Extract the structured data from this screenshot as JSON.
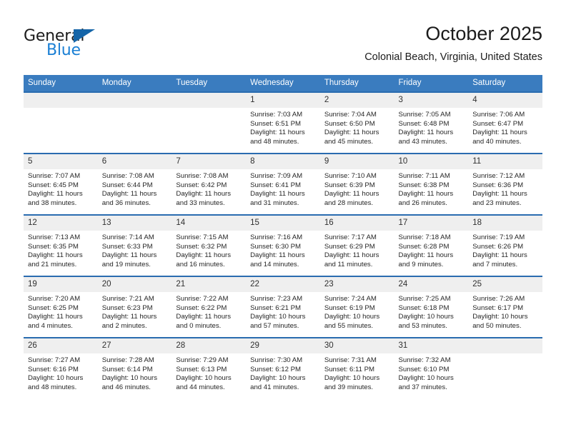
{
  "brand": {
    "name_top": "General",
    "name_bottom": "Blue",
    "triangle_color": "#1565a8",
    "blue_color": "#1a7fd4"
  },
  "header": {
    "title": "October 2025",
    "subtitle": "Colonial Beach, Virginia, United States"
  },
  "theme": {
    "header_blue": "#3a7cbf",
    "row_rule_blue": "#2a6cb0",
    "daynum_band": "#efefef"
  },
  "weekdays": [
    "Sunday",
    "Monday",
    "Tuesday",
    "Wednesday",
    "Thursday",
    "Friday",
    "Saturday"
  ],
  "weeks": [
    [
      {
        "day": "",
        "lines": []
      },
      {
        "day": "",
        "lines": []
      },
      {
        "day": "",
        "lines": []
      },
      {
        "day": "1",
        "lines": [
          "Sunrise: 7:03 AM",
          "Sunset: 6:51 PM",
          "Daylight: 11 hours",
          "and 48 minutes."
        ]
      },
      {
        "day": "2",
        "lines": [
          "Sunrise: 7:04 AM",
          "Sunset: 6:50 PM",
          "Daylight: 11 hours",
          "and 45 minutes."
        ]
      },
      {
        "day": "3",
        "lines": [
          "Sunrise: 7:05 AM",
          "Sunset: 6:48 PM",
          "Daylight: 11 hours",
          "and 43 minutes."
        ]
      },
      {
        "day": "4",
        "lines": [
          "Sunrise: 7:06 AM",
          "Sunset: 6:47 PM",
          "Daylight: 11 hours",
          "and 40 minutes."
        ]
      }
    ],
    [
      {
        "day": "5",
        "lines": [
          "Sunrise: 7:07 AM",
          "Sunset: 6:45 PM",
          "Daylight: 11 hours",
          "and 38 minutes."
        ]
      },
      {
        "day": "6",
        "lines": [
          "Sunrise: 7:08 AM",
          "Sunset: 6:44 PM",
          "Daylight: 11 hours",
          "and 36 minutes."
        ]
      },
      {
        "day": "7",
        "lines": [
          "Sunrise: 7:08 AM",
          "Sunset: 6:42 PM",
          "Daylight: 11 hours",
          "and 33 minutes."
        ]
      },
      {
        "day": "8",
        "lines": [
          "Sunrise: 7:09 AM",
          "Sunset: 6:41 PM",
          "Daylight: 11 hours",
          "and 31 minutes."
        ]
      },
      {
        "day": "9",
        "lines": [
          "Sunrise: 7:10 AM",
          "Sunset: 6:39 PM",
          "Daylight: 11 hours",
          "and 28 minutes."
        ]
      },
      {
        "day": "10",
        "lines": [
          "Sunrise: 7:11 AM",
          "Sunset: 6:38 PM",
          "Daylight: 11 hours",
          "and 26 minutes."
        ]
      },
      {
        "day": "11",
        "lines": [
          "Sunrise: 7:12 AM",
          "Sunset: 6:36 PM",
          "Daylight: 11 hours",
          "and 23 minutes."
        ]
      }
    ],
    [
      {
        "day": "12",
        "lines": [
          "Sunrise: 7:13 AM",
          "Sunset: 6:35 PM",
          "Daylight: 11 hours",
          "and 21 minutes."
        ]
      },
      {
        "day": "13",
        "lines": [
          "Sunrise: 7:14 AM",
          "Sunset: 6:33 PM",
          "Daylight: 11 hours",
          "and 19 minutes."
        ]
      },
      {
        "day": "14",
        "lines": [
          "Sunrise: 7:15 AM",
          "Sunset: 6:32 PM",
          "Daylight: 11 hours",
          "and 16 minutes."
        ]
      },
      {
        "day": "15",
        "lines": [
          "Sunrise: 7:16 AM",
          "Sunset: 6:30 PM",
          "Daylight: 11 hours",
          "and 14 minutes."
        ]
      },
      {
        "day": "16",
        "lines": [
          "Sunrise: 7:17 AM",
          "Sunset: 6:29 PM",
          "Daylight: 11 hours",
          "and 11 minutes."
        ]
      },
      {
        "day": "17",
        "lines": [
          "Sunrise: 7:18 AM",
          "Sunset: 6:28 PM",
          "Daylight: 11 hours",
          "and 9 minutes."
        ]
      },
      {
        "day": "18",
        "lines": [
          "Sunrise: 7:19 AM",
          "Sunset: 6:26 PM",
          "Daylight: 11 hours",
          "and 7 minutes."
        ]
      }
    ],
    [
      {
        "day": "19",
        "lines": [
          "Sunrise: 7:20 AM",
          "Sunset: 6:25 PM",
          "Daylight: 11 hours",
          "and 4 minutes."
        ]
      },
      {
        "day": "20",
        "lines": [
          "Sunrise: 7:21 AM",
          "Sunset: 6:23 PM",
          "Daylight: 11 hours",
          "and 2 minutes."
        ]
      },
      {
        "day": "21",
        "lines": [
          "Sunrise: 7:22 AM",
          "Sunset: 6:22 PM",
          "Daylight: 11 hours",
          "and 0 minutes."
        ]
      },
      {
        "day": "22",
        "lines": [
          "Sunrise: 7:23 AM",
          "Sunset: 6:21 PM",
          "Daylight: 10 hours",
          "and 57 minutes."
        ]
      },
      {
        "day": "23",
        "lines": [
          "Sunrise: 7:24 AM",
          "Sunset: 6:19 PM",
          "Daylight: 10 hours",
          "and 55 minutes."
        ]
      },
      {
        "day": "24",
        "lines": [
          "Sunrise: 7:25 AM",
          "Sunset: 6:18 PM",
          "Daylight: 10 hours",
          "and 53 minutes."
        ]
      },
      {
        "day": "25",
        "lines": [
          "Sunrise: 7:26 AM",
          "Sunset: 6:17 PM",
          "Daylight: 10 hours",
          "and 50 minutes."
        ]
      }
    ],
    [
      {
        "day": "26",
        "lines": [
          "Sunrise: 7:27 AM",
          "Sunset: 6:16 PM",
          "Daylight: 10 hours",
          "and 48 minutes."
        ]
      },
      {
        "day": "27",
        "lines": [
          "Sunrise: 7:28 AM",
          "Sunset: 6:14 PM",
          "Daylight: 10 hours",
          "and 46 minutes."
        ]
      },
      {
        "day": "28",
        "lines": [
          "Sunrise: 7:29 AM",
          "Sunset: 6:13 PM",
          "Daylight: 10 hours",
          "and 44 minutes."
        ]
      },
      {
        "day": "29",
        "lines": [
          "Sunrise: 7:30 AM",
          "Sunset: 6:12 PM",
          "Daylight: 10 hours",
          "and 41 minutes."
        ]
      },
      {
        "day": "30",
        "lines": [
          "Sunrise: 7:31 AM",
          "Sunset: 6:11 PM",
          "Daylight: 10 hours",
          "and 39 minutes."
        ]
      },
      {
        "day": "31",
        "lines": [
          "Sunrise: 7:32 AM",
          "Sunset: 6:10 PM",
          "Daylight: 10 hours",
          "and 37 minutes."
        ]
      },
      {
        "day": "",
        "lines": []
      }
    ]
  ]
}
